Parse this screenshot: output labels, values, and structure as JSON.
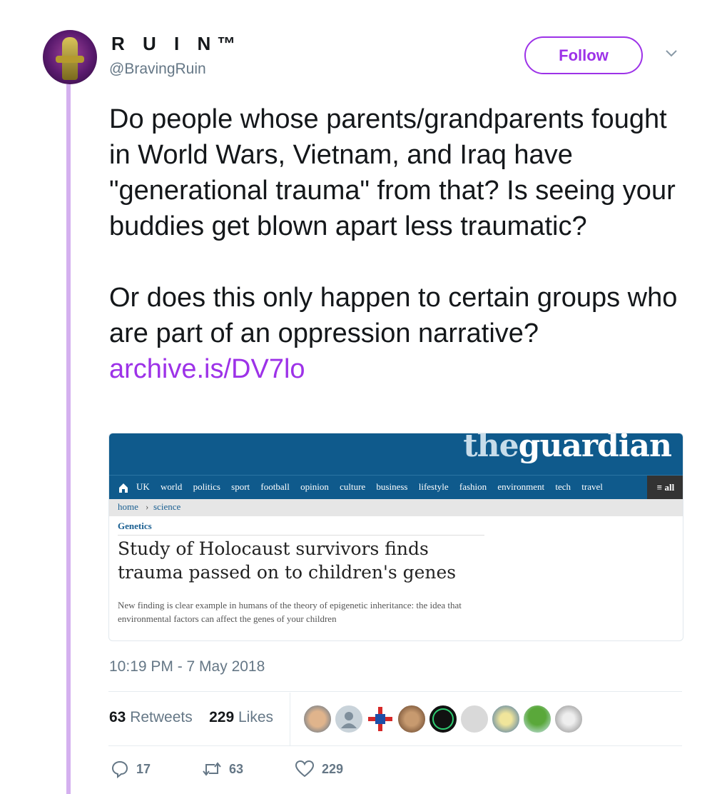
{
  "user": {
    "name": "R U I N™",
    "handle": "@BravingRuin"
  },
  "follow_label": "Follow",
  "tweet": {
    "text": "Do people whose parents/grandparents fought in World Wars, Vietnam, and Iraq have \"generational trauma\" from that? Is seeing your buddies get blown apart less traumatic?\n\nOr does this only happen to certain groups who are part of an oppression narrative? ",
    "link": "archive.is/DV7lo"
  },
  "card": {
    "logo_the": "the",
    "logo_guardian": "guardian",
    "nav": [
      "UK",
      "world",
      "politics",
      "sport",
      "football",
      "opinion",
      "culture",
      "business",
      "lifestyle",
      "fashion",
      "environment",
      "tech",
      "travel"
    ],
    "nav_all": "≡ all",
    "breadcrumb": {
      "home": "home",
      "sep": "›",
      "section": "science"
    },
    "section_label": "Genetics",
    "headline": "Study of Holocaust survivors finds trauma passed on to children's genes",
    "standfirst": "New finding is clear example in humans of the theory of epigenetic inheritance: the idea that environmental factors can affect the genes of your children"
  },
  "timestamp": "10:19 PM - 7 May 2018",
  "stats": {
    "retweets_count": "63",
    "retweets_label": "Retweets",
    "likes_count": "229",
    "likes_label": "Likes"
  },
  "actions": {
    "replies": "17",
    "retweets": "63",
    "likes": "229"
  },
  "colors": {
    "accent": "#9d32e8",
    "thread_line": "#d4b0ef",
    "guardian_blue": "#0f5a8c",
    "muted": "#657786"
  }
}
